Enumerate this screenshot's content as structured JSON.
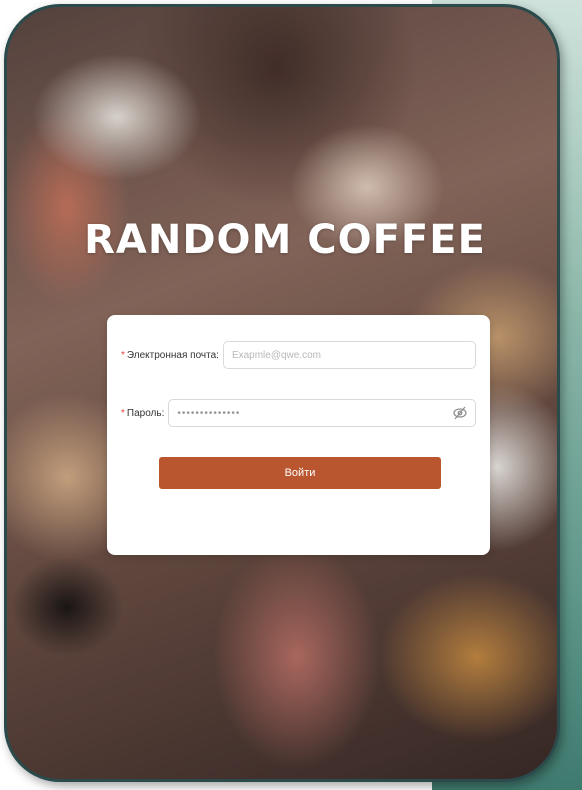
{
  "app": {
    "title": "RANDOM COFFEE"
  },
  "login_form": {
    "email": {
      "label": "Электронная почта:",
      "placeholder": "Exapmle@qwe.com",
      "value": "",
      "required": true
    },
    "password": {
      "label": "Пароль:",
      "value": "••••••••••••••",
      "required": true,
      "toggle_icon": "eye-slash-icon"
    },
    "submit_label": "Войти"
  },
  "colors": {
    "accent": "#b9562f",
    "required_mark": "#e0463c",
    "frame_border": "#2a4a4c",
    "side_accent": "#5f978a"
  }
}
